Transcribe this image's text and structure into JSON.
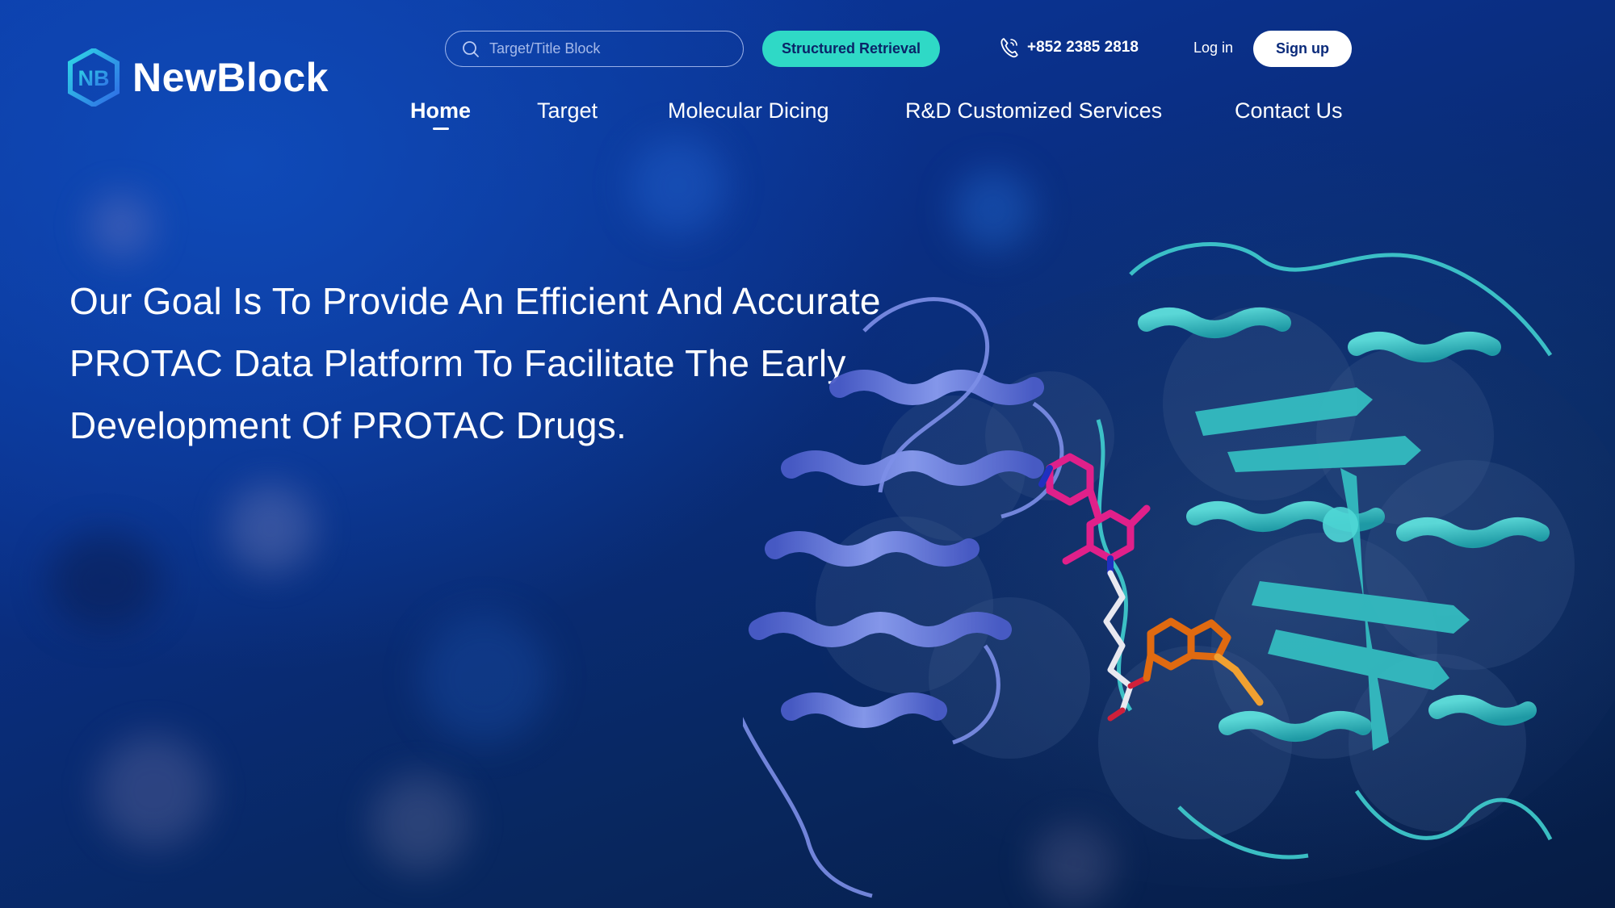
{
  "brand": {
    "name": "NewBlock",
    "logo_letters": "NB"
  },
  "header": {
    "search_placeholder": "Target/Title Block",
    "structured_button": "Structured Retrieval",
    "phone": "+852 2385 2818",
    "login": "Log in",
    "signup": "Sign up"
  },
  "nav": {
    "items": [
      {
        "label": "Home",
        "active": true
      },
      {
        "label": "Target"
      },
      {
        "label": "Molecular Dicing"
      },
      {
        "label": "R&D Customized Services"
      },
      {
        "label": "Contact Us"
      }
    ]
  },
  "hero": {
    "line1": "Our Goal Is To Provide An Efficient And Accurate",
    "line2": "PROTAC Data Platform To Facilitate The Early",
    "line3": "Development Of PROTAC Drugs."
  },
  "icons": {
    "search": "search-icon",
    "phone": "phone-icon",
    "logo": "hexagon-logo-icon"
  },
  "colors": {
    "accent": "#2fd9c6",
    "background": "#0a2f86",
    "protein_a": "#6a7ee0",
    "protein_b": "#3ec9c9",
    "ligand_magenta": "#e0208a",
    "ligand_orange": "#e06a10"
  }
}
